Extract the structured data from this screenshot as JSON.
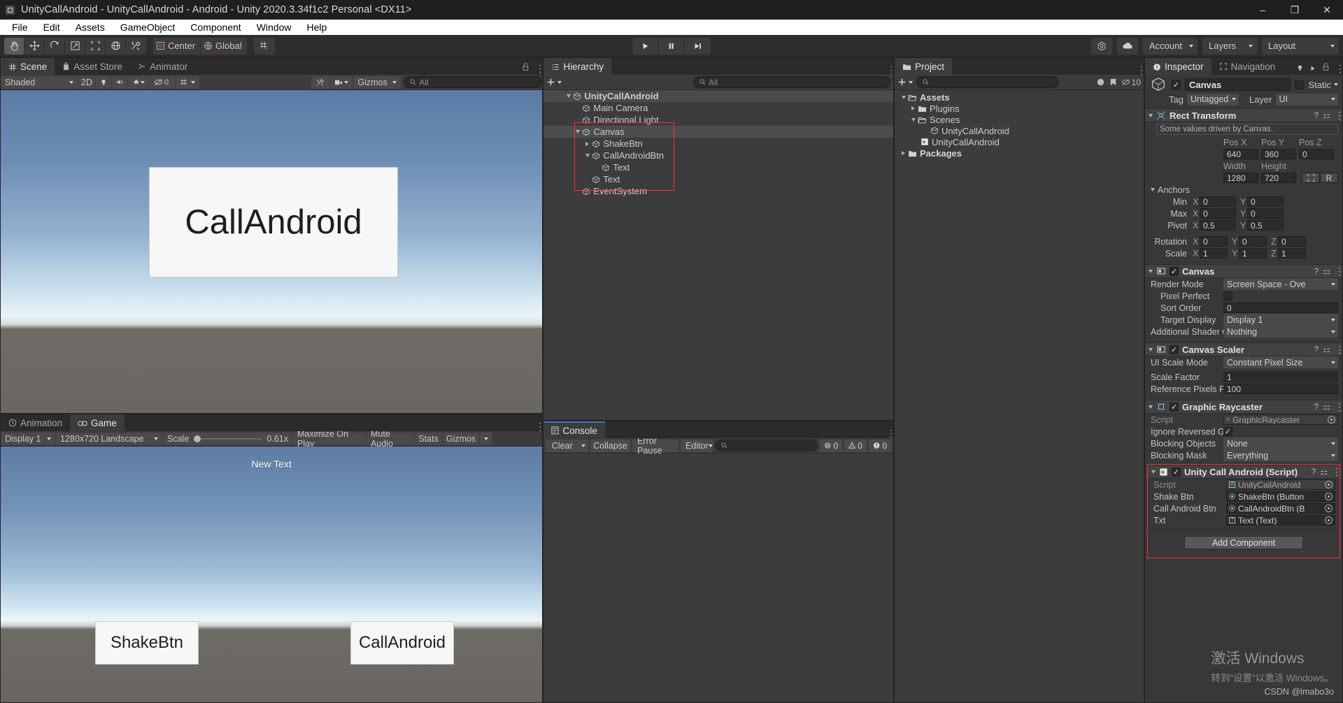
{
  "window": {
    "title": "UnityCallAndroid - UnityCallAndroid - Android - Unity 2020.3.34f1c2 Personal <DX11>",
    "minimize": "–",
    "maximize": "❐",
    "close": "✕"
  },
  "menubar": {
    "items": [
      "File",
      "Edit",
      "Assets",
      "GameObject",
      "Component",
      "Window",
      "Help"
    ]
  },
  "toolbar": {
    "tools": [
      "hand-tool",
      "move-tool",
      "rotate-tool",
      "scale-tool",
      "rect-tool",
      "transform-tool",
      "custom-tool"
    ],
    "pivot_label": "Center",
    "space_label": "Global",
    "grid_label": "grid-snap",
    "play": "▶",
    "pause": "❙❙",
    "step": "▶❘",
    "collab_label": "collab-icon",
    "cloud_label": "cloud-icon",
    "account": "Account",
    "layers": "Layers",
    "layout": "Layout"
  },
  "scene_panel": {
    "tabs": [
      {
        "label": "Scene",
        "icon": "grid-icon",
        "active": true
      },
      {
        "label": "Asset Store",
        "icon": "bag-icon",
        "active": false
      },
      {
        "label": "Animator",
        "icon": "animator-icon",
        "active": false
      }
    ],
    "shading": "Shaded",
    "mode_2d": "2D",
    "lighting": "light-icon",
    "audio": "audio-icon",
    "fx": "fx-icon",
    "hidden_count": "0",
    "gizmos": "Gizmos",
    "search_placeholder": "All",
    "card_text": "CallAndroid"
  },
  "game_panel": {
    "tabs": [
      {
        "label": "Animation",
        "icon": "clock-icon",
        "active": false
      },
      {
        "label": "Game",
        "icon": "gamepad-icon",
        "active": true
      }
    ],
    "display": "Display 1",
    "aspect": "1280x720 Landscape",
    "scale_label": "Scale",
    "scale_value": "0.61x",
    "maximize": "Maximize On Play",
    "mute": "Mute Audio",
    "stats": "Stats",
    "gizmos": "Gizmos",
    "text_label": "New Text",
    "button_shake": "ShakeBtn",
    "button_call": "CallAndroid"
  },
  "hierarchy": {
    "tab": "Hierarchy",
    "add_label": "+",
    "search_placeholder": "All",
    "items": [
      {
        "label": "UnityCallAndroid",
        "depth": 0,
        "caret": "down",
        "icon": "scene-icon",
        "bold": true,
        "selected": false
      },
      {
        "label": "Main Camera",
        "depth": 1,
        "caret": "none",
        "icon": "gameobject-icon",
        "bold": false,
        "selected": false
      },
      {
        "label": "Directional Light",
        "depth": 1,
        "caret": "none",
        "icon": "gameobject-icon",
        "bold": false,
        "selected": false
      },
      {
        "label": "Canvas",
        "depth": 1,
        "caret": "down",
        "icon": "gameobject-icon",
        "bold": false,
        "selected": true
      },
      {
        "label": "ShakeBtn",
        "depth": 2,
        "caret": "right",
        "icon": "gameobject-icon",
        "bold": false,
        "selected": false
      },
      {
        "label": "CallAndroidBtn",
        "depth": 2,
        "caret": "down",
        "icon": "gameobject-icon",
        "bold": false,
        "selected": false
      },
      {
        "label": "Text",
        "depth": 3,
        "caret": "none",
        "icon": "gameobject-icon",
        "bold": false,
        "selected": false
      },
      {
        "label": "Text",
        "depth": 2,
        "caret": "none",
        "icon": "gameobject-icon",
        "bold": false,
        "selected": false
      },
      {
        "label": "EventSystem",
        "depth": 1,
        "caret": "none",
        "icon": "gameobject-icon",
        "bold": false,
        "selected": false
      }
    ],
    "highlight_color": "#ff2d2d"
  },
  "project": {
    "tab": "Project",
    "add_label": "+",
    "search_placeholder": "",
    "item_count": "10",
    "items": [
      {
        "label": "Assets",
        "depth": 0,
        "caret": "down",
        "icon": "folder-open-icon",
        "bold": true
      },
      {
        "label": "Plugins",
        "depth": 1,
        "caret": "right",
        "icon": "folder-icon",
        "bold": false
      },
      {
        "label": "Scenes",
        "depth": 1,
        "caret": "down",
        "icon": "folder-open-icon",
        "bold": false
      },
      {
        "label": "UnityCallAndroid",
        "depth": 2,
        "caret": "none",
        "icon": "scene-icon",
        "bold": false
      },
      {
        "label": "UnityCallAndroid",
        "depth": 1,
        "caret": "none",
        "icon": "cs-script-icon",
        "bold": false
      },
      {
        "label": "Packages",
        "depth": 0,
        "caret": "right",
        "icon": "folder-icon",
        "bold": true
      }
    ]
  },
  "console": {
    "tab": "Console",
    "clear": "Clear",
    "collapse": "Collapse",
    "error_pause": "Error Pause",
    "editor": "Editor",
    "search_placeholder": "",
    "log_count": "0",
    "warn_count": "0",
    "error_count": "0"
  },
  "inspector": {
    "tabs": [
      {
        "label": "Inspector",
        "icon": "info-icon",
        "active": true
      },
      {
        "label": "Navigation",
        "icon": "navigation-icon",
        "active": false
      }
    ],
    "object_name": "Canvas",
    "object_enabled": "✓",
    "static_label": "Static",
    "tag_label": "Tag",
    "tag_value": "Untagged",
    "layer_label": "Layer",
    "layer_value": "UI",
    "components": [
      {
        "name": "Rect Transform",
        "icon": "rect-transform-icon",
        "has_checkbox": false,
        "note": "Some values driven by Canvas.",
        "columns": [
          "Pos X",
          "Pos Y",
          "Pos Z"
        ],
        "pos": [
          "640",
          "360",
          "0"
        ],
        "columns2": [
          "Width",
          "Height"
        ],
        "size": [
          "1280",
          "720"
        ],
        "blueprint_btn": "blueprint-icon",
        "raw_btn": "R",
        "anchors_label": "Anchors",
        "anchor_rows": [
          {
            "name": "Min",
            "x": "0",
            "y": "0"
          },
          {
            "name": "Max",
            "x": "0",
            "y": "0"
          },
          {
            "name": "Pivot",
            "x": "0.5",
            "y": "0.5"
          }
        ],
        "transform_rows": [
          {
            "name": "Rotation",
            "x": "0",
            "y": "0",
            "z": "0"
          },
          {
            "name": "Scale",
            "x": "1",
            "y": "1",
            "z": "1"
          }
        ]
      },
      {
        "name": "Canvas",
        "icon": "canvas-icon",
        "has_checkbox": true,
        "rows": [
          {
            "name": "Render Mode",
            "type": "dropdown",
            "value": "Screen Space - Ove"
          },
          {
            "name": "Pixel Perfect",
            "type": "checkbox",
            "value": ""
          },
          {
            "name": "Sort Order",
            "type": "field",
            "value": "0"
          },
          {
            "name": "Target Display",
            "type": "dropdown",
            "value": "Display 1"
          },
          {
            "name": "Additional Shader Ch",
            "type": "dropdown",
            "value": "Nothing"
          }
        ]
      },
      {
        "name": "Canvas Scaler",
        "icon": "canvas-scaler-icon",
        "has_checkbox": true,
        "rows": [
          {
            "name": "UI Scale Mode",
            "type": "dropdown",
            "value": "Constant Pixel Size"
          },
          {
            "name": "Scale Factor",
            "type": "field",
            "value": "1"
          },
          {
            "name": "Reference Pixels Per",
            "type": "field",
            "value": "100"
          }
        ]
      },
      {
        "name": "Graphic Raycaster",
        "icon": "graphic-raycaster-icon",
        "has_checkbox": true,
        "rows": [
          {
            "name": "Script",
            "type": "objref-ro",
            "value": "GraphicRaycaster"
          },
          {
            "name": "Ignore Reversed Grap",
            "type": "checkbox",
            "value": "✓"
          },
          {
            "name": "Blocking Objects",
            "type": "dropdown",
            "value": "None"
          },
          {
            "name": "Blocking Mask",
            "type": "dropdown",
            "value": "Everything"
          }
        ]
      },
      {
        "name": "Unity Call Android (Script)",
        "icon": "cs-script-icon",
        "has_checkbox": true,
        "highlighted": true,
        "rows": [
          {
            "name": "Script",
            "type": "objref-ro",
            "value": "UnityCallAndroid"
          },
          {
            "name": "Shake Btn",
            "type": "objref",
            "value": "ShakeBtn (Button"
          },
          {
            "name": "Call Android Btn",
            "type": "objref",
            "value": "CallAndroidBtn (B"
          },
          {
            "name": "Txt",
            "type": "objref",
            "value": "Text (Text)"
          }
        ]
      }
    ],
    "add_component": "Add Component"
  },
  "watermark": {
    "line1": "激活 Windows",
    "line2": "转到“设置”以激活 Windows。",
    "line3": "CSDN @lmabo3o"
  }
}
